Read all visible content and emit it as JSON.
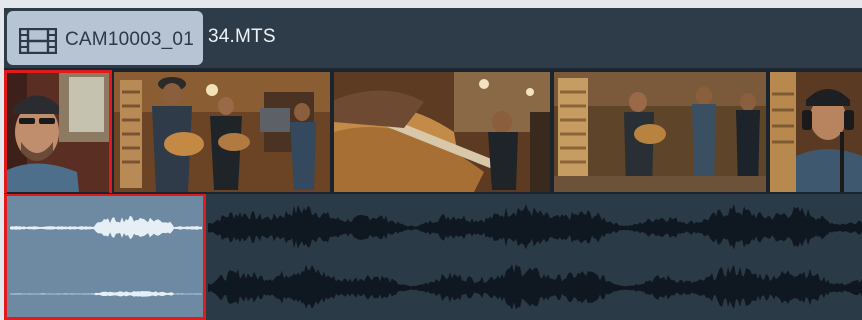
{
  "clip": {
    "name_prefix": "CAM10003_01",
    "name_suffix": "34.MTS"
  },
  "colors": {
    "track_bg": "#2b3946",
    "tab_bg": "#b6c4d3",
    "selection": "#e01b1b",
    "audio_selected_bg": "#6e8aa3",
    "waveform": "#0f1720",
    "waveform_selected": "#e6eef6"
  },
  "icons": {
    "clip_type": "film-strip-icon"
  },
  "thumbnails": [
    {
      "subject": "musician-with-cap-closeup"
    },
    {
      "subject": "band-playing-guitars-wide"
    },
    {
      "subject": "guitar-neck-closeup"
    },
    {
      "subject": "band-in-studio-wide"
    },
    {
      "subject": "musician-with-headphones"
    }
  ]
}
